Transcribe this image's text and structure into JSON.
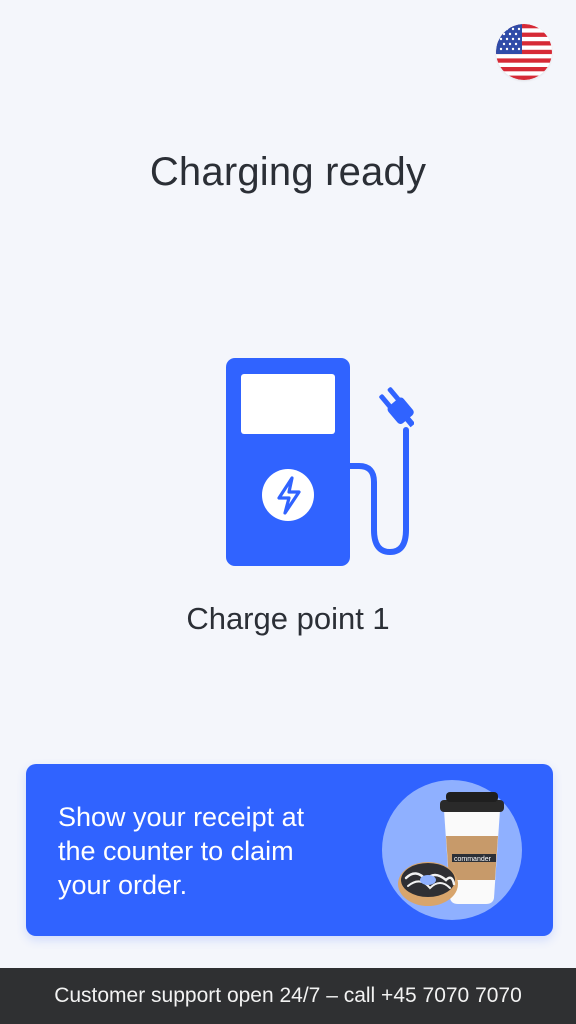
{
  "header": {
    "language_icon": "us-flag-icon"
  },
  "status": {
    "title": "Charging ready"
  },
  "charger": {
    "icon": "ev-charger-icon",
    "point_label": "Charge point 1",
    "accent_color": "#3063ff"
  },
  "promo": {
    "text": "Show your receipt at the counter to claim your order.",
    "image": "coffee-and-donut-image",
    "cup_brand": "commander",
    "background_color": "#3063ff"
  },
  "footer": {
    "support_text": "Customer support open 24/7 – call +45 7070 7070"
  }
}
